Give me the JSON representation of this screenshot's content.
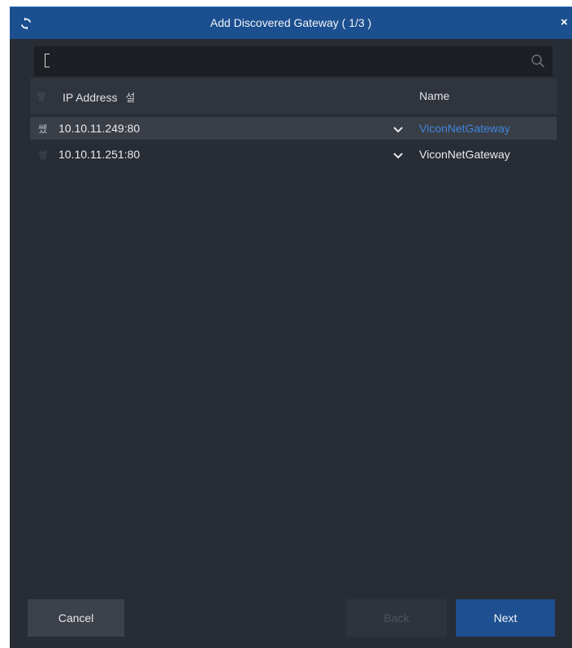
{
  "dialog": {
    "title": "Add Discovered Gateway ( 1/3 )",
    "close_label": "×",
    "refresh_icon": "refresh-icon"
  },
  "search": {
    "value": "",
    "placeholder": "",
    "icon": "search-icon"
  },
  "table": {
    "columns": {
      "ip": "IP Address",
      "ip_sort_glyph": "설",
      "name": "Name",
      "check_glyph": "쌓"
    },
    "rows": [
      {
        "check": "쌨",
        "ip": "10.10.11.249:80",
        "name": "ViconNetGateway",
        "selected": true
      },
      {
        "check": "쌓",
        "ip": "10.10.11.251:80",
        "name": "ViconNetGateway",
        "selected": false
      }
    ]
  },
  "buttons": {
    "cancel": "Cancel",
    "back": "Back",
    "next": "Next"
  },
  "colors": {
    "titlebar": "#1b4f8f",
    "background": "#282c34",
    "accent_link": "#3d86de",
    "next_button": "#1d4f91"
  }
}
